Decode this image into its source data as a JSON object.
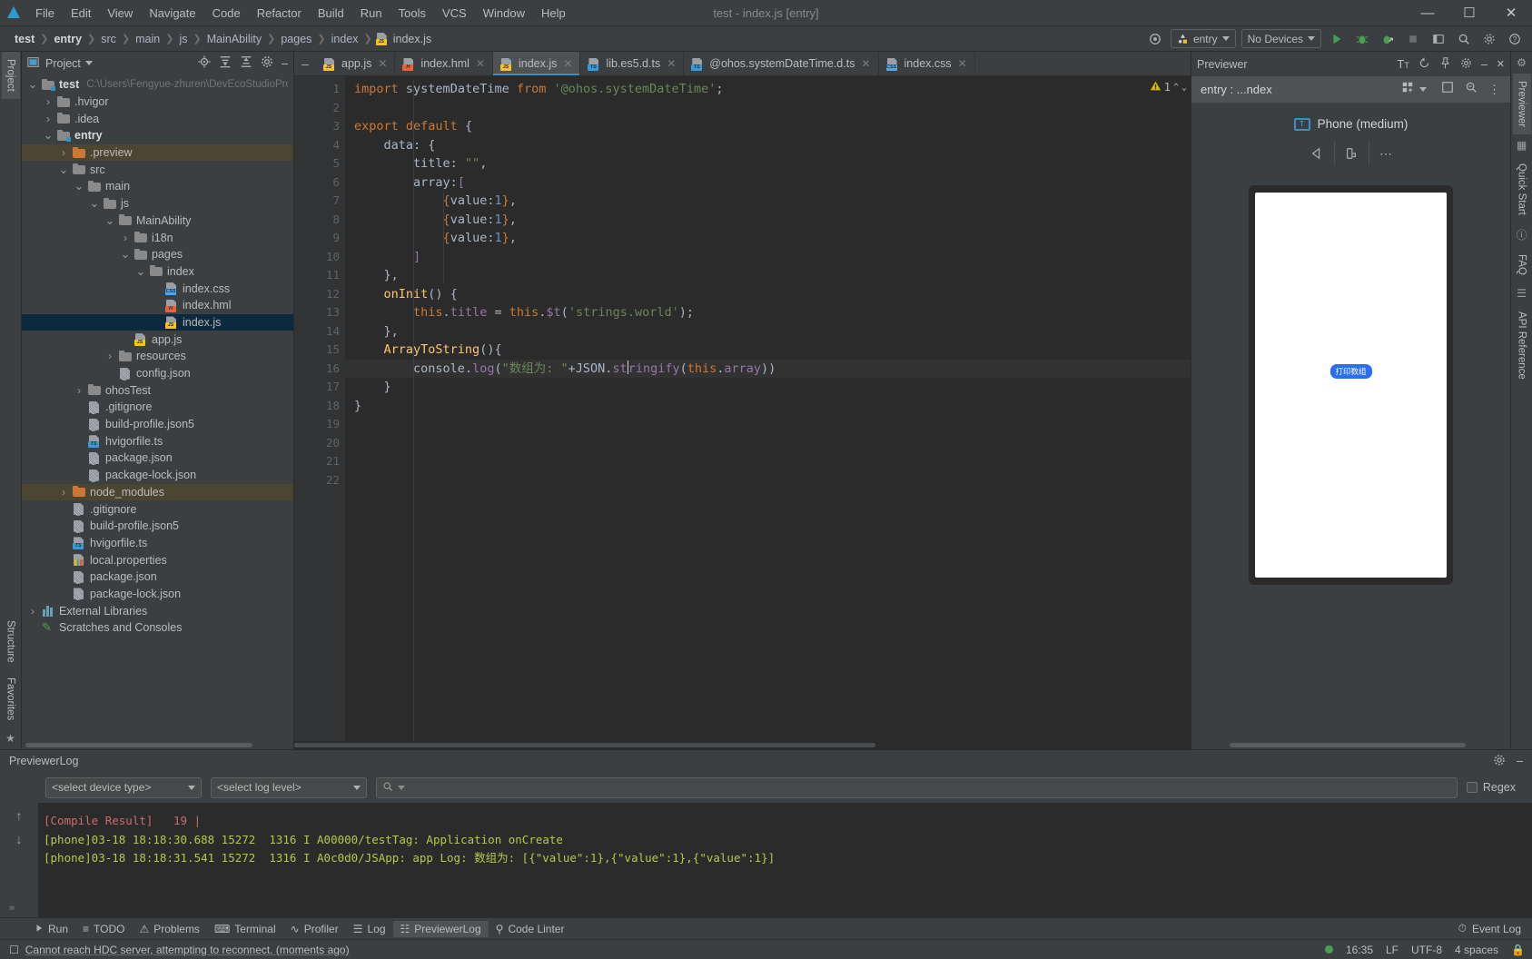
{
  "titlebar": {
    "window_title": "test - index.js [entry]",
    "menus": [
      "File",
      "Edit",
      "View",
      "Navigate",
      "Code",
      "Refactor",
      "Build",
      "Run",
      "Tools",
      "VCS",
      "Window",
      "Help"
    ],
    "controls": {
      "minimize": "—",
      "maximize": "❐",
      "close": "✕"
    }
  },
  "navbar": {
    "breadcrumbs": [
      "test",
      "entry",
      "src",
      "main",
      "js",
      "MainAbility",
      "pages",
      "index"
    ],
    "current_file": "index.js",
    "run_config": "entry",
    "device_selector": "No Devices",
    "icons": [
      "target-icon",
      "run-icon",
      "debug-icon",
      "attach-debugger-icon",
      "stop-icon",
      "layout-icon",
      "search-icon",
      "settings-icon",
      "help-icon"
    ]
  },
  "left_rail": {
    "tabs": [
      "Project",
      "Structure",
      "Favorites"
    ]
  },
  "right_rail": {
    "tabs": [
      "Previewer",
      "Quick Start",
      "FAQ",
      "API Reference"
    ]
  },
  "project_panel": {
    "title": "Project",
    "actions": [
      "locate-icon",
      "expand-all-icon",
      "collapse-all-icon",
      "gear-icon",
      "minimize-icon"
    ],
    "tree": [
      {
        "label": "test",
        "path": "C:\\Users\\Fengyue-zhuren\\DevEcoStudioPro",
        "indent": 0,
        "arrow": "expanded",
        "icon": "module-folder",
        "bold": true
      },
      {
        "label": ".hvigor",
        "indent": 1,
        "arrow": "collapsed",
        "icon": "folder"
      },
      {
        "label": ".idea",
        "indent": 1,
        "arrow": "collapsed",
        "icon": "folder"
      },
      {
        "label": "entry",
        "indent": 1,
        "arrow": "expanded",
        "icon": "module-folder",
        "bold": true
      },
      {
        "label": ".preview",
        "indent": 2,
        "arrow": "collapsed",
        "icon": "folder-orange",
        "highlight": true
      },
      {
        "label": "src",
        "indent": 2,
        "arrow": "expanded",
        "icon": "folder"
      },
      {
        "label": "main",
        "indent": 3,
        "arrow": "expanded",
        "icon": "folder"
      },
      {
        "label": "js",
        "indent": 4,
        "arrow": "expanded",
        "icon": "folder"
      },
      {
        "label": "MainAbility",
        "indent": 5,
        "arrow": "expanded",
        "icon": "folder"
      },
      {
        "label": "i18n",
        "indent": 6,
        "arrow": "collapsed",
        "icon": "folder"
      },
      {
        "label": "pages",
        "indent": 6,
        "arrow": "expanded",
        "icon": "folder"
      },
      {
        "label": "index",
        "indent": 7,
        "arrow": "expanded",
        "icon": "folder"
      },
      {
        "label": "index.css",
        "indent": 8,
        "arrow": "none",
        "icon": "file-css"
      },
      {
        "label": "index.hml",
        "indent": 8,
        "arrow": "none",
        "icon": "file-html"
      },
      {
        "label": "index.js",
        "indent": 8,
        "arrow": "none",
        "icon": "file-js",
        "selected": true
      },
      {
        "label": "app.js",
        "indent": 6,
        "arrow": "none",
        "icon": "file-js"
      },
      {
        "label": "resources",
        "indent": 5,
        "arrow": "collapsed",
        "icon": "folder"
      },
      {
        "label": "config.json",
        "indent": 5,
        "arrow": "none",
        "icon": "file-json"
      },
      {
        "label": "ohosTest",
        "indent": 3,
        "arrow": "collapsed",
        "icon": "folder"
      },
      {
        "label": ".gitignore",
        "indent": 3,
        "arrow": "none",
        "icon": "file-gitignore"
      },
      {
        "label": "build-profile.json5",
        "indent": 3,
        "arrow": "none",
        "icon": "file-json"
      },
      {
        "label": "hvigorfile.ts",
        "indent": 3,
        "arrow": "none",
        "icon": "file-ts"
      },
      {
        "label": "package.json",
        "indent": 3,
        "arrow": "none",
        "icon": "file-json"
      },
      {
        "label": "package-lock.json",
        "indent": 3,
        "arrow": "none",
        "icon": "file-json"
      },
      {
        "label": "node_modules",
        "indent": 2,
        "arrow": "collapsed",
        "icon": "folder-orange",
        "highlight": true
      },
      {
        "label": ".gitignore",
        "indent": 2,
        "arrow": "none",
        "icon": "file-gitignore"
      },
      {
        "label": "build-profile.json5",
        "indent": 2,
        "arrow": "none",
        "icon": "file-json"
      },
      {
        "label": "hvigorfile.ts",
        "indent": 2,
        "arrow": "none",
        "icon": "file-ts"
      },
      {
        "label": "local.properties",
        "indent": 2,
        "arrow": "none",
        "icon": "file-properties"
      },
      {
        "label": "package.json",
        "indent": 2,
        "arrow": "none",
        "icon": "file-json"
      },
      {
        "label": "package-lock.json",
        "indent": 2,
        "arrow": "none",
        "icon": "file-json"
      },
      {
        "label": "External Libraries",
        "indent": 0,
        "arrow": "collapsed",
        "icon": "library"
      },
      {
        "label": "Scratches and Consoles",
        "indent": 0,
        "arrow": "none",
        "icon": "scratch"
      }
    ]
  },
  "editor": {
    "tabs": [
      {
        "label": "app.js",
        "icon": "file-js",
        "active": false
      },
      {
        "label": "index.hml",
        "icon": "file-html",
        "active": false
      },
      {
        "label": "index.js",
        "icon": "file-js",
        "active": true
      },
      {
        "label": "lib.es5.d.ts",
        "icon": "file-ts",
        "active": false
      },
      {
        "label": "@ohos.systemDateTime.d.ts",
        "icon": "file-ts",
        "active": false
      },
      {
        "label": "index.css",
        "icon": "file-css",
        "active": false
      }
    ],
    "warning_count": "1",
    "line_numbers": [
      "1",
      "2",
      "3",
      "4",
      "5",
      "6",
      "7",
      "8",
      "9",
      "10",
      "11",
      "12",
      "13",
      "14",
      "15",
      "16",
      "17",
      "18",
      "19",
      "20",
      "21",
      "22"
    ],
    "code_lines": [
      "import systemDateTime from '@ohos.systemDateTime';",
      "",
      "export default {",
      "    data: {",
      "        title: \"\",",
      "        array:[",
      "            {value:1},",
      "            {value:1},",
      "            {value:1},",
      "        ]",
      "    },",
      "    onInit() {",
      "        this.title = this.$t('strings.world');",
      "    },",
      "    ArrayToString(){",
      "        console.log(\"数组为: \"+JSON.stringify(this.array))",
      "    }",
      "}",
      "",
      "",
      "",
      ""
    ],
    "cursor_line": 16
  },
  "previewer": {
    "title": "Previewer",
    "header_actions": [
      "font-size-icon",
      "refresh-icon",
      "pin-icon",
      "settings-icon",
      "minimize-icon",
      "close-icon"
    ],
    "subtitle": "entry : ...ndex",
    "sub_actions": [
      "multi-device-icon",
      "chevron-down-icon",
      "rotate-icon",
      "zoom-icon",
      "more-icon"
    ],
    "device_name": "Phone (medium)",
    "device_badge": "T",
    "device_controls": [
      "back-icon",
      "rotate-device-icon",
      "more-icon"
    ],
    "preview_button_label": "打印数组"
  },
  "log_panel": {
    "title": "PreviewerLog",
    "device_type_select": "<select device type>",
    "log_level_select": "<select log level>",
    "search_placeholder": "",
    "regex_label": "Regex",
    "lines": [
      {
        "text": "[Compile Result]   19 |",
        "color": "red"
      },
      {
        "text": "[phone]03-18 18:18:30.688 15272  1316 I A00000/testTag: Application onCreate",
        "color": "green"
      },
      {
        "text": "[phone]03-18 18:18:31.541 15272  1316 I A0c0d0/JSApp: app Log: 数组为: [{\"value\":1},{\"value\":1},{\"value\":1}]",
        "color": "green"
      }
    ]
  },
  "tool_windows": {
    "items": [
      {
        "label": "Run",
        "icon": "run-icon",
        "selected": false
      },
      {
        "label": "TODO",
        "icon": "todo-icon",
        "selected": false
      },
      {
        "label": "Problems",
        "icon": "problems-icon",
        "selected": false
      },
      {
        "label": "Terminal",
        "icon": "terminal-icon",
        "selected": false
      },
      {
        "label": "Profiler",
        "icon": "profiler-icon",
        "selected": false
      },
      {
        "label": "Log",
        "icon": "log-icon",
        "selected": false
      },
      {
        "label": "PreviewerLog",
        "icon": "previewer-log-icon",
        "selected": true
      },
      {
        "label": "Code Linter",
        "icon": "code-linter-icon",
        "selected": false
      }
    ],
    "event_log": "Event Log"
  },
  "status_bar": {
    "message": "Cannot reach HDC server, attempting to reconnect. (moments ago)",
    "time": "16:35",
    "line_sep": "LF",
    "encoding": "UTF-8",
    "indent": "4 spaces"
  },
  "colors": {
    "accent": "#3592c4",
    "selection": "#0d293e",
    "highlight": "#4b4632",
    "preview_button": "#2c6ef2",
    "log_green": "#b3c94c",
    "log_red": "#cf6a6a"
  }
}
